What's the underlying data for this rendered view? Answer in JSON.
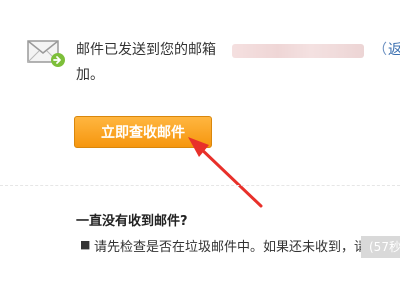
{
  "message": {
    "line1": "邮件已发送到您的邮箱",
    "paren": "（",
    "cut_link": "返",
    "line2": "加。"
  },
  "button": {
    "label": "立即查收邮件"
  },
  "faq": {
    "title": "一直没有收到邮件?",
    "bullet": "■",
    "text": "请先检查是否在垃圾邮件中。如果还未收到，请",
    "countdown": "(57秒"
  },
  "colors": {
    "button": "#f6960e",
    "arrow": "#e8302a",
    "link": "#3a6fb0"
  },
  "icons": {
    "mail": "envelope-with-arrow-icon",
    "annotation": "red-arrow"
  }
}
